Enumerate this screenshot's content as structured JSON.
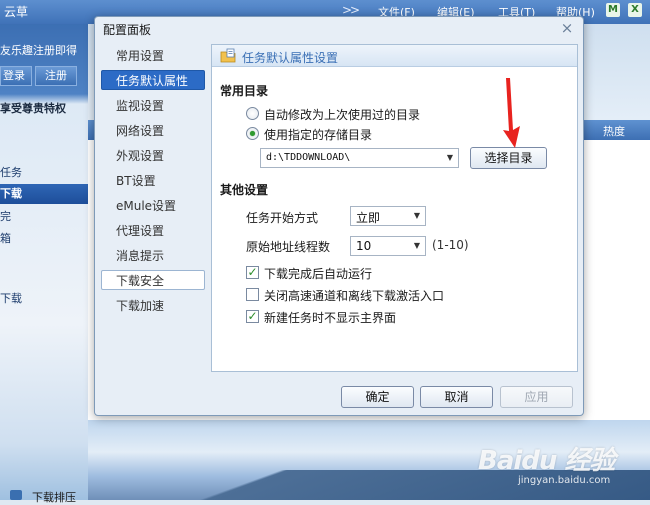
{
  "background_app": {
    "title_fragment": "云草",
    "menu": [
      "文件(F)",
      "编辑(E)",
      "工具(T)",
      "帮助(H)"
    ],
    "promo_text": "友乐趣注册即得",
    "login_label": "登录",
    "register_label": "注册",
    "vip_text": "享受尊贵特权",
    "left_items": [
      "任务",
      "下载",
      "完",
      "箱",
      "下载"
    ],
    "column_heat": "热度",
    "bottom_text": "下载排压",
    "watermark": "Baidu 经验",
    "watermark_sub": "jingyan.baidu.com"
  },
  "dialog": {
    "title": "配置面板",
    "close_glyph": "×",
    "nav": [
      {
        "label": "常用设置"
      },
      {
        "label": "任务默认属性",
        "selected": true
      },
      {
        "label": "监视设置"
      },
      {
        "label": "网络设置"
      },
      {
        "label": "外观设置"
      },
      {
        "label": "BT设置"
      },
      {
        "label": "eMule设置"
      },
      {
        "label": "代理设置"
      },
      {
        "label": "消息提示"
      },
      {
        "label": "下载安全"
      },
      {
        "label": "下载加速"
      }
    ],
    "panel_title": "任务默认属性设置",
    "common_dir": {
      "heading": "常用目录",
      "option_last": "自动修改为上次使用过的目录",
      "option_specified": "使用指定的存储目录",
      "selected_option": "option_specified",
      "path_value": "d:\\TDDOWNLOAD\\",
      "choose_dir_button": "选择目录"
    },
    "other_settings": {
      "heading": "其他设置",
      "start_mode_label": "任务开始方式",
      "start_mode_value": "立即",
      "threads_label": "原始地址线程数",
      "threads_value": "10",
      "threads_range": "(1-10)",
      "checks": [
        {
          "label": "下载完成后自动运行",
          "checked": true
        },
        {
          "label": "关闭高速通道和离线下载激活入口",
          "checked": false
        },
        {
          "label": "新建任务时不显示主界面",
          "checked": true
        }
      ]
    },
    "buttons": {
      "ok": "确定",
      "cancel": "取消",
      "apply": "应用"
    }
  },
  "colors": {
    "selected_nav": "#2c6bc6",
    "check_green": "#2b8d2b",
    "annotation_red": "#e8231f"
  },
  "icons": {
    "panel_header": "folder-settings-icon",
    "dropdown": "chevron-down-icon",
    "checkmark": "check-icon"
  }
}
